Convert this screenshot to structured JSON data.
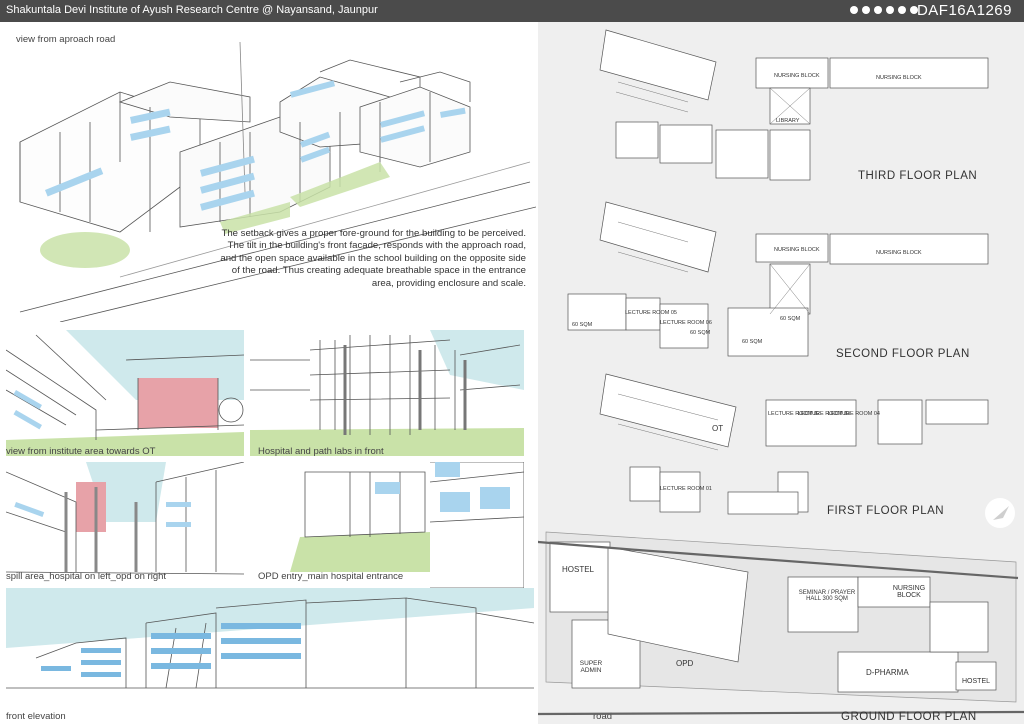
{
  "header": {
    "title": "Shakuntala Devi Institute of Ayush Research Centre @ Nayansand, Jaunpur",
    "code": "DAF16A1269",
    "dot_count": 6
  },
  "captions": {
    "approach": "view from aproach road",
    "ot_view": "view from institute area towards OT",
    "path_labs": "Hospital and path labs in front",
    "spill": "spill area_hospital on left_opd on right",
    "opd_entry": "OPD entry_main hospital entrance",
    "elevation": "front elevation",
    "road": "road"
  },
  "description": "The setback gives a proper fore-ground for the building to be perceived. The tilt in the building's front facade, responds with the approach road, and the open space available in the school building on the opposite side of the road. Thus creating adequate breathable space in the entrance area, providing enclosure and scale.",
  "plans": {
    "third": "THIRD FLOOR PLAN",
    "second": "SECOND FLOOR PLAN",
    "first": "FIRST FLOOR PLAN",
    "ground": "GROUND FLOOR PLAN"
  },
  "rooms": {
    "third_nursing_a": "NURSING BLOCK",
    "third_nursing_b": "NURSING BLOCK",
    "library": "LIBRARY",
    "second_nursing_a": "NURSING BLOCK",
    "second_nursing_b": "NURSING BLOCK",
    "sqm_60_a": "60 SQM",
    "sqm_60_b": "60 SQM",
    "sqm_60_c": "60 SQM",
    "sqm_60_d": "60 SQM",
    "lr_05": "LECTURE ROOM 05",
    "lr_06": "LECTURE ROOM 06",
    "lr_02": "LECTURE ROOM 02",
    "lr_03": "LECTURE ROOM 03",
    "lr_04": "LECTURE ROOM 04",
    "lr_01": "LECTURE ROOM 01",
    "ot": "OT",
    "hostel_a": "HOSTEL",
    "hostel_b": "HOSTEL",
    "seminar": "SEMINAR / PRAYER HALL 300 SQM",
    "nursing_ground": "NURSING BLOCK",
    "super_admin": "SUPER ADMIN",
    "opd": "OPD",
    "d_pharma": "D-PHARMA"
  },
  "colors": {
    "header_bg": "#4b4b4b",
    "panel_bg": "#efefef",
    "glass_blue": "#a9d4ee",
    "lawn_green": "#c9e2a8",
    "ot_red": "#e7a2a8"
  }
}
